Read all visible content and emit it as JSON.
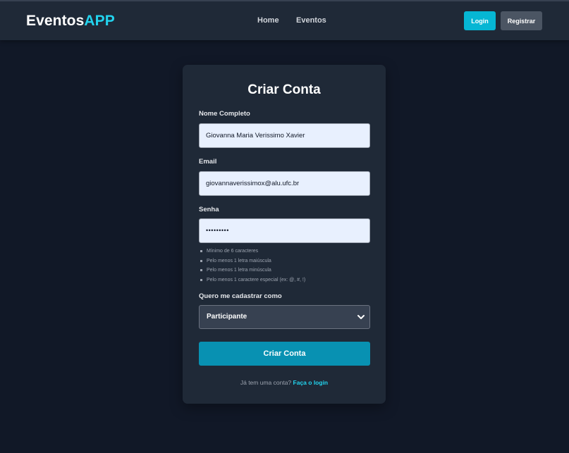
{
  "brand": {
    "name": "Eventos",
    "accent": "APP"
  },
  "nav": {
    "home": "Home",
    "eventos": "Eventos"
  },
  "auth": {
    "login": "Login",
    "registrar": "Registrar"
  },
  "form": {
    "title": "Criar Conta",
    "nome_label": "Nome Completo",
    "nome_value": "Giovanna Maria Verissimo Xavier",
    "email_label": "Email",
    "email_value": "giovannaverissimox@alu.ufc.br",
    "senha_label": "Senha",
    "senha_value": "•••••••••",
    "requirements": [
      "Mínimo de 6 caracteres",
      "Pelo menos 1 letra maiúscula",
      "Pelo menos 1 letra minúscula",
      "Pelo menos 1 caractere especial (ex: @, #, !)"
    ],
    "tipo_label": "Quero me cadastrar como",
    "tipo_value": "Participante",
    "submit": "Criar Conta",
    "footer_text": "Já tem uma conta?",
    "footer_link": "Faça o login"
  },
  "colors": {
    "background": "#111827",
    "surface": "#1f2937",
    "accent": "#22d3ee",
    "primary_button": "#0891b2",
    "login_button": "#06b6d4"
  },
  "icons": {
    "select_chevron": "chevron-down-icon"
  }
}
